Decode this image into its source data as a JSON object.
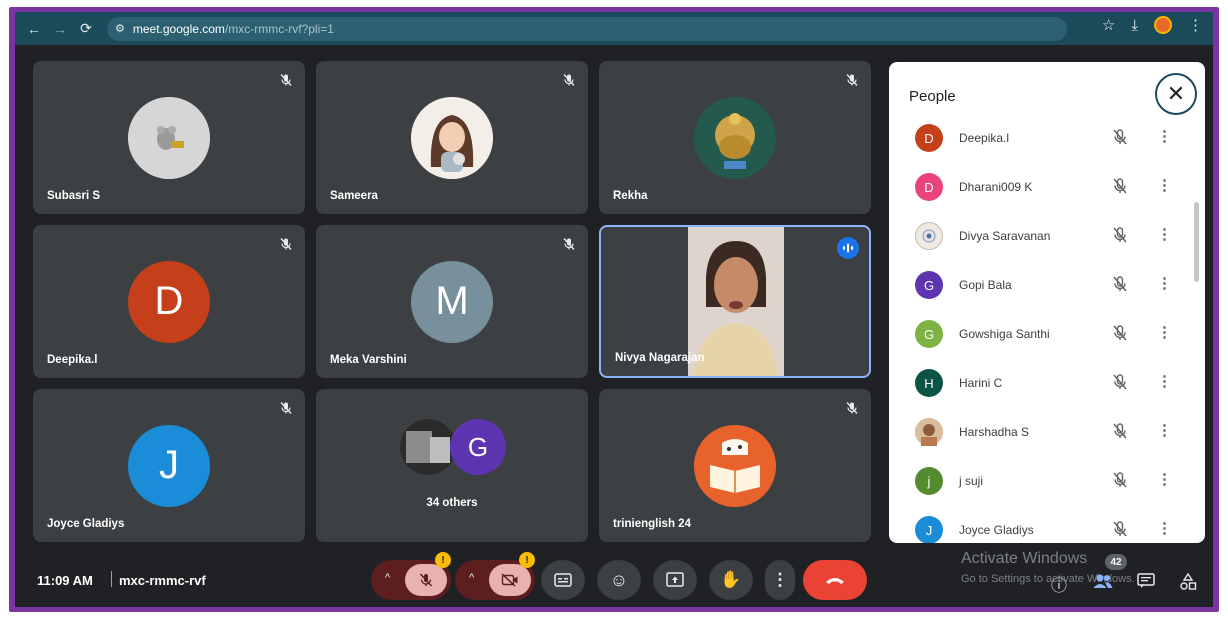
{
  "browser": {
    "url_host": "meet.google.com",
    "url_path": "/mxc-rmmc-rvf?pli=1"
  },
  "tiles": [
    {
      "name": "Subasri S",
      "avatar_type": "photo",
      "muted": true
    },
    {
      "name": "Sameera",
      "avatar_type": "photo",
      "muted": true
    },
    {
      "name": "Rekha",
      "avatar_type": "photo",
      "muted": true
    },
    {
      "name": "Deepika.l",
      "initial": "D",
      "avatar_color": "#c5401a",
      "muted": true
    },
    {
      "name": "Meka Varshini",
      "initial": "M",
      "avatar_color": "#78909c",
      "muted": true
    },
    {
      "name": "Nivya Nagarajan",
      "avatar_type": "video",
      "speaking": true
    },
    {
      "name": "Joyce Gladiys",
      "initial": "J",
      "avatar_color": "#1a73e8",
      "muted": true
    },
    {
      "name": "34 others",
      "initial": "G",
      "avatar_color": "#5e35b1"
    },
    {
      "name": "trinienglish 24",
      "avatar_type": "photo",
      "muted": true
    }
  ],
  "people_panel": {
    "title": "People",
    "participants": [
      {
        "name": "Deepika.l",
        "initial": "D",
        "color": "#c5401a"
      },
      {
        "name": "Dharani009 K",
        "initial": "D",
        "color": "#e8437a"
      },
      {
        "name": "Divya Saravanan",
        "initial": "",
        "color": "#d7ccc8"
      },
      {
        "name": "Gopi Bala",
        "initial": "G",
        "color": "#5e35b1"
      },
      {
        "name": "Gowshiga Santhi",
        "initial": "G",
        "color": "#7cb342"
      },
      {
        "name": "Harini C",
        "initial": "H",
        "color": "#0b5345"
      },
      {
        "name": "Harshadha S",
        "initial": "",
        "color": "#d7b899"
      },
      {
        "name": "j suji",
        "initial": "j",
        "color": "#558b2f"
      },
      {
        "name": "Joyce Gladiys",
        "initial": "J",
        "color": "#1a73e8"
      }
    ]
  },
  "meeting": {
    "time": "11:09 AM",
    "code": "mxc-rmmc-rvf"
  },
  "watermark": {
    "title": "Activate Windows",
    "subtitle": "Go to Settings to activate Windows."
  },
  "participant_count": "42",
  "colors": {
    "accent_blue": "#8ab4f8",
    "leave_red": "#ea4335",
    "warning_yellow": "#fbbc04"
  }
}
